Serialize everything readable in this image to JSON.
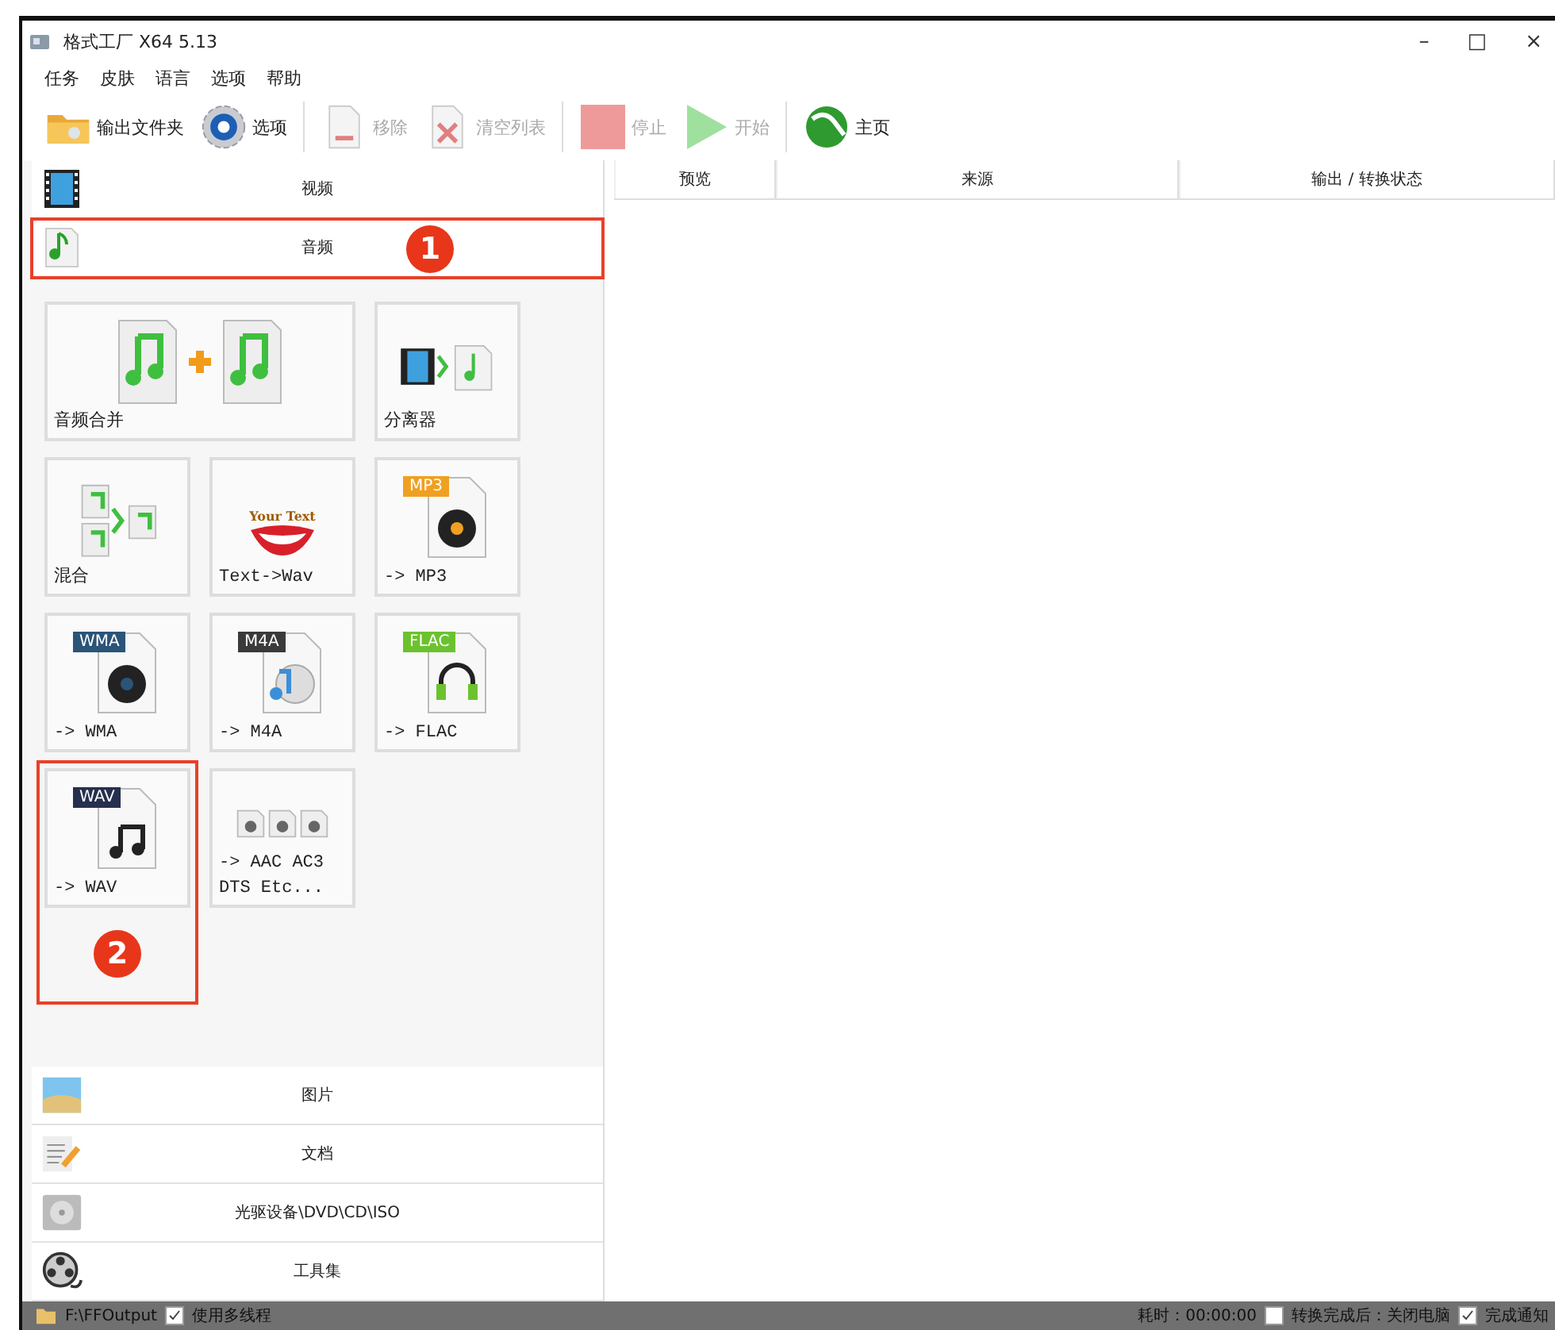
{
  "window": {
    "title": "格式工厂 X64 5.13",
    "controls": [
      "–",
      "□",
      "×"
    ]
  },
  "menu": [
    "任务",
    "皮肤",
    "语言",
    "选项",
    "帮助"
  ],
  "toolbar": [
    [
      {
        "kind": "folder",
        "label": "输出文件夹",
        "disabled": false
      },
      {
        "kind": "gear",
        "label": "选项",
        "disabled": false
      }
    ],
    [
      {
        "kind": "remove",
        "label": "移除",
        "disabled": true
      },
      {
        "kind": "clear",
        "label": "清空列表",
        "disabled": true
      }
    ],
    [
      {
        "kind": "stop",
        "label": "停止",
        "disabled": true
      },
      {
        "kind": "start",
        "label": "开始",
        "disabled": true
      }
    ],
    [
      {
        "kind": "globe",
        "label": "主页",
        "disabled": false
      }
    ]
  ],
  "categories": [
    {
      "kind": "video",
      "label": "视频",
      "expanded": false
    },
    {
      "kind": "audio",
      "label": "音频",
      "expanded": true,
      "marker": "1",
      "tiles": [
        {
          "kind": "merge",
          "label": "音频合并",
          "wide": true
        },
        {
          "kind": "splitter",
          "label": "分离器",
          "wide": false
        },
        {
          "kind": "mix",
          "label": "混合",
          "wide": false
        },
        {
          "kind": "tts",
          "label": "Text->Wav",
          "badge": "Your Text",
          "wide": false
        },
        {
          "kind": "disc",
          "label": "-> MP3",
          "badge": "MP3",
          "color": "#f0a020",
          "wide": false
        },
        {
          "kind": "disc",
          "label": "-> WMA",
          "badge": "WMA",
          "color": "#2a5478",
          "wide": false
        },
        {
          "kind": "cd",
          "label": "-> M4A",
          "badge": "M4A",
          "color": "#3a3a3a",
          "wide": false
        },
        {
          "kind": "headphones",
          "label": "-> FLAC",
          "badge": "FLAC",
          "color": "#6cc22e",
          "wide": false
        },
        {
          "kind": "notes",
          "label": "-> WAV",
          "badge": "WAV",
          "color": "#26304e",
          "wide": false,
          "marker": "2"
        },
        {
          "kind": "multi",
          "label": "-> AAC AC3 DTS Etc...",
          "wide": false
        }
      ]
    },
    {
      "kind": "picture",
      "label": "图片",
      "expanded": false
    },
    {
      "kind": "document",
      "label": "文档",
      "expanded": false
    },
    {
      "kind": "optical",
      "label": "光驱设备\\DVD\\CD\\ISO",
      "expanded": false
    },
    {
      "kind": "tools",
      "label": "工具集",
      "expanded": false
    }
  ],
  "table": {
    "columns": [
      "预览",
      "来源",
      "输出 / 转换状态"
    ]
  },
  "status_bar": {
    "output_folder": "F:\\FFOutput",
    "multithread": {
      "label": "使用多线程",
      "checked": true
    },
    "elapsed": "耗时：00:00:00",
    "shutdown": {
      "label": "转换完成后：关闭电脑",
      "checked": false
    },
    "notify": {
      "label": "完成通知",
      "checked": true
    }
  }
}
